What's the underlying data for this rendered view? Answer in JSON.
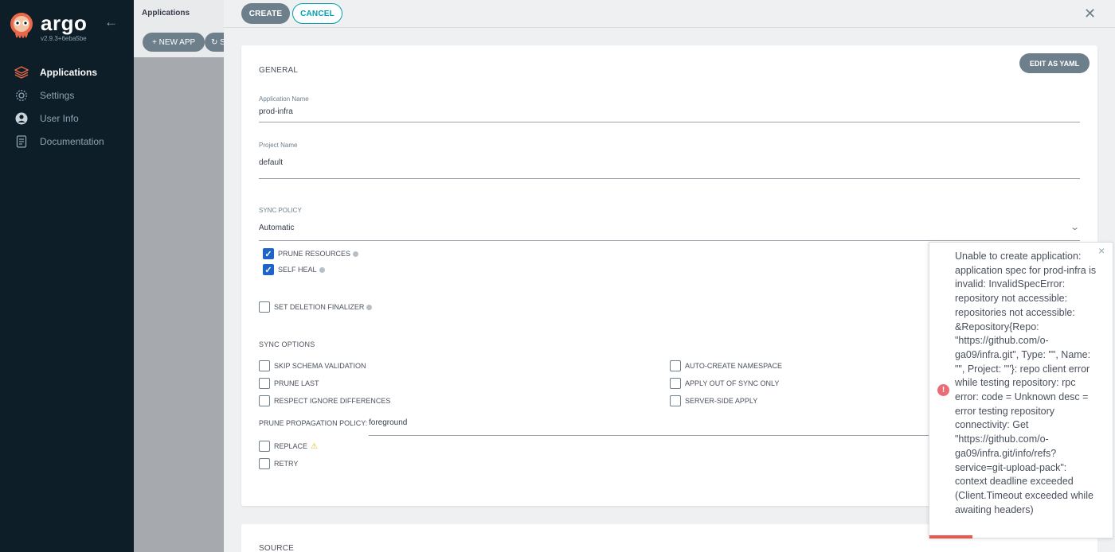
{
  "sidebar": {
    "brand": "argo",
    "version": "v2.9.3+6eba5be",
    "items": [
      {
        "label": "Applications",
        "icon": "layers-icon"
      },
      {
        "label": "Settings",
        "icon": "gear-icon"
      },
      {
        "label": "User Info",
        "icon": "user-icon"
      },
      {
        "label": "Documentation",
        "icon": "book-icon"
      }
    ]
  },
  "background": {
    "title": "Applications",
    "new_app": "+ NEW APP",
    "sync_label": "S"
  },
  "panel": {
    "create": "CREATE",
    "cancel": "CANCEL",
    "edit_yaml": "EDIT AS YAML",
    "general_title": "GENERAL",
    "app_name_label": "Application Name",
    "app_name_value": "prod-infra",
    "project_label": "Project Name",
    "project_value": "default",
    "sync_policy_label": "SYNC POLICY",
    "sync_policy_value": "Automatic",
    "prune_resources": "PRUNE RESOURCES",
    "self_heal": "SELF HEAL",
    "deletion_finalizer": "SET DELETION FINALIZER",
    "sync_options_title": "SYNC OPTIONS",
    "skip_schema": "SKIP SCHEMA VALIDATION",
    "prune_last": "PRUNE LAST",
    "respect_ignore": "RESPECT IGNORE DIFFERENCES",
    "auto_create_ns": "AUTO-CREATE NAMESPACE",
    "apply_out_of_sync": "APPLY OUT OF SYNC ONLY",
    "server_side_apply": "SERVER-SIDE APPLY",
    "prune_prop_label": "PRUNE PROPAGATION POLICY:",
    "prune_prop_value": "foreground",
    "replace": "REPLACE",
    "retry": "RETRY",
    "source_title": "SOURCE"
  },
  "notification": {
    "message": "Unable to create application: application spec for prod-infra is invalid: InvalidSpecError: repository not accessible: repositories not accessible: &Repository{Repo: \"https://github.com/o-ga09/infra.git\", Type: \"\", Name: \"\", Project: \"\"}: repo client error while testing repository: rpc error: code = Unknown desc = error testing repository connectivity: Get \"https://github.com/o-ga09/infra.git/info/refs?service=git-upload-pack\": context deadline exceeded (Client.Timeout exceeded while awaiting headers)"
  }
}
